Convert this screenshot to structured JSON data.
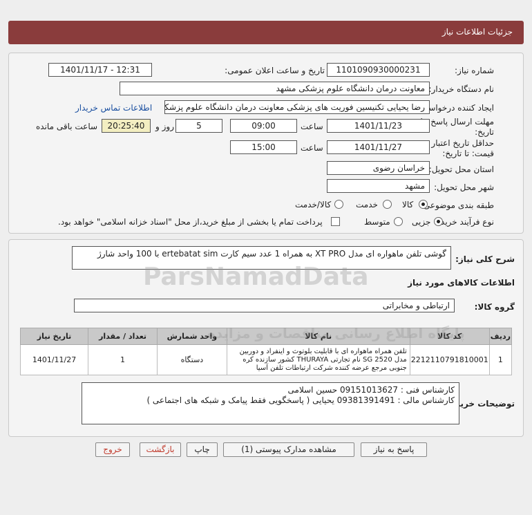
{
  "header": {
    "title": "جزئیات اطلاعات نیاز"
  },
  "form": {
    "need_number_label": "شماره نیاز:",
    "need_number": "1101090930000231",
    "announce_label": "تاریخ و ساعت اعلان عمومی:",
    "announce_value": "1401/11/17 - 12:31",
    "buyer_org_label": "نام دستگاه خریدار:",
    "buyer_org": "معاونت درمان دانشگاه علوم پزشکی مشهد",
    "creator_label": "ایجاد کننده درخواست:",
    "creator": "رضا یحیایی تکنیسین فوریت های پزشکی معاونت درمان دانشگاه علوم پزشکی م",
    "contact_link": "اطلاعات تماس خریدار",
    "deadline_label_1": "مهلت ارسال پاسخ: تا",
    "deadline_label_2": "تاریخ:",
    "deadline_date": "1401/11/23",
    "time_label": "ساعت",
    "deadline_time": "09:00",
    "days_value": "5",
    "days_label": "روز و",
    "remaining_time": "20:25:40",
    "remaining_label": "ساعت باقی مانده",
    "validity_label_1": "حداقل تاریخ اعتبار",
    "validity_label_2": "قیمت: تا تاریخ:",
    "validity_date": "1401/11/27",
    "validity_time_label": "ساعت",
    "validity_time": "15:00",
    "province_label": "استان محل تحویل:",
    "province": "خراسان رضوی",
    "city_label": "شهر محل تحویل:",
    "city": "مشهد",
    "category_label": "طبقه بندی موضوعی:",
    "category_options": [
      "کالا",
      "خدمت",
      "کالا/خدمت"
    ],
    "process_label": "نوع فرآیند خرید :",
    "process_options": [
      "جزیی",
      "متوسط"
    ],
    "payment_note": "پرداخت تمام یا بخشی از مبلغ خرید،از محل \"اسناد خزانه اسلامی\" خواهد بود."
  },
  "description": {
    "label": "شرح کلی نیاز:",
    "text": "گوشی تلفن ماهواره ای مدل XT PRO به همراه 1 عدد سیم کارت ertebatat sim با 100 واحد شارژ"
  },
  "goods_section_title": "اطلاعات کالاهای مورد نیاز",
  "goods_group_label": "گروه کالا:",
  "goods_group": "ارتباطی و مخابراتی",
  "table": {
    "headers": [
      "ردیف",
      "کد کالا",
      "نام کالا",
      "واحد شمارش",
      "تعداد / مقدار",
      "تاریخ نیاز"
    ],
    "rows": [
      {
        "row": "1",
        "code": "2212110791810001",
        "name": "تلفن همراه ماهواره ای با قابلیت بلوتوث و اینفراد و دوربین مدل SG 2520 نام تجارتی THURAYA کشور سازنده کره جنوبی مرجع عرضه کننده شرکت ارتباطات تلفن آسیا",
        "unit": "دستگاه",
        "qty": "1",
        "date": "1401/11/27"
      }
    ]
  },
  "buyer_notes": {
    "label": "توضیحات خریدار:",
    "line1": "کارشناس فنی : 09151013627 حسین اسلامی",
    "line2": "کارشناس مالی : 09381391491 یحیایی ( پاسخگویی فقط پیامک و شبکه های اجتماعی )"
  },
  "buttons": {
    "reply": "پاسخ به نیاز",
    "attachments": "مشاهده مدارک پیوستی (1)",
    "print": "چاپ",
    "back": "بازگشت",
    "exit": "خروج"
  },
  "watermark": {
    "brand": "ParsNamadData",
    "tagline": "پایگاه اطلاع رسانی مناقصات و مزایده"
  },
  "colors": {
    "header": "#8a3c3c",
    "link": "#1a4fa0",
    "danger": "#c0392b",
    "remaining_bg": "#f3eec1"
  }
}
